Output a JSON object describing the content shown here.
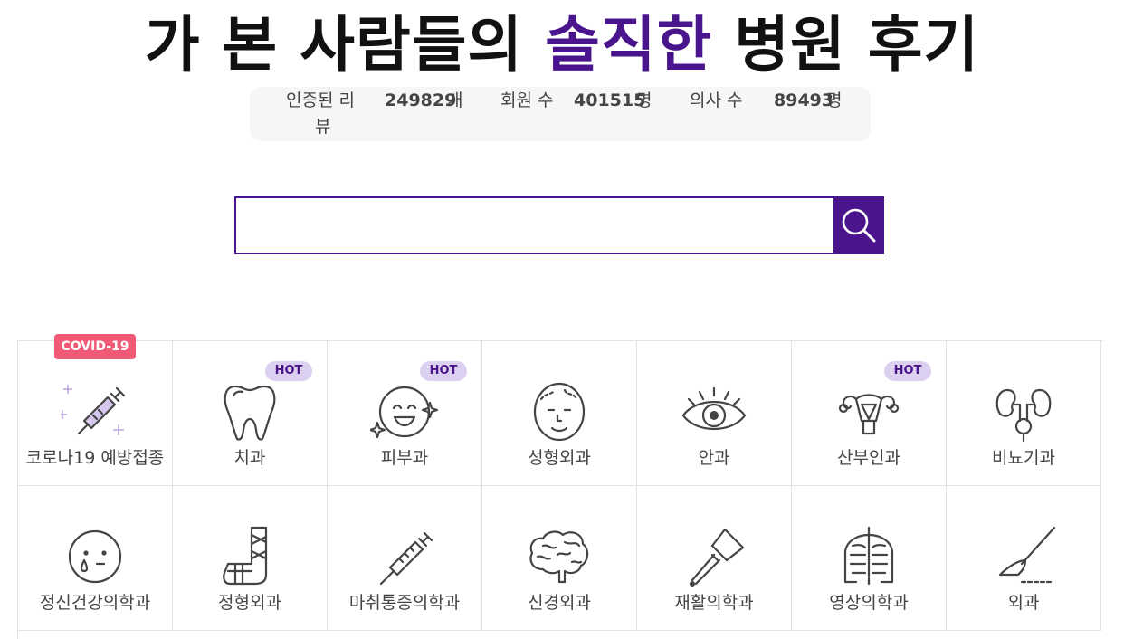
{
  "headline": {
    "part1": "가 본 사람들의 ",
    "highlight": "솔직한",
    "part2": " 병원 후기"
  },
  "stats": {
    "reviews_label_line1": "인증된 리",
    "reviews_label_line2": "뷰",
    "reviews_count": "249829",
    "reviews_unit": "개",
    "members_label": "회원 수",
    "members_count": "401515",
    "members_unit": "명",
    "doctors_label": "의사 수",
    "doctors_count": "89493",
    "doctors_unit": "명"
  },
  "search": {
    "value": "",
    "placeholder": ""
  },
  "categories": [
    {
      "label": "코로나19 예방접종",
      "badge": "COVID-19",
      "icon": "vaccine-syringe-icon"
    },
    {
      "label": "치과",
      "badge": "HOT",
      "icon": "tooth-icon"
    },
    {
      "label": "피부과",
      "badge": "HOT",
      "icon": "smiling-face-icon"
    },
    {
      "label": "성형외과",
      "badge": "",
      "icon": "face-icon"
    },
    {
      "label": "안과",
      "badge": "",
      "icon": "eye-icon"
    },
    {
      "label": "산부인과",
      "badge": "HOT",
      "icon": "uterus-icon"
    },
    {
      "label": "비뇨기과",
      "badge": "",
      "icon": "kidney-icon"
    },
    {
      "label": "정신건강의학과",
      "badge": "",
      "icon": "crying-face-icon"
    },
    {
      "label": "정형외과",
      "badge": "",
      "icon": "leg-cast-icon"
    },
    {
      "label": "마취통증의학과",
      "badge": "",
      "icon": "syringe-icon"
    },
    {
      "label": "신경외과",
      "badge": "",
      "icon": "brain-icon"
    },
    {
      "label": "재활의학과",
      "badge": "",
      "icon": "crutch-icon"
    },
    {
      "label": "영상의학과",
      "badge": "",
      "icon": "xray-icon"
    },
    {
      "label": "외과",
      "badge": "",
      "icon": "scalpel-icon"
    }
  ],
  "colors": {
    "accent": "#4a148c",
    "hot_badge_bg": "#dcd0f0",
    "covid_badge_bg": "#f15a77"
  }
}
